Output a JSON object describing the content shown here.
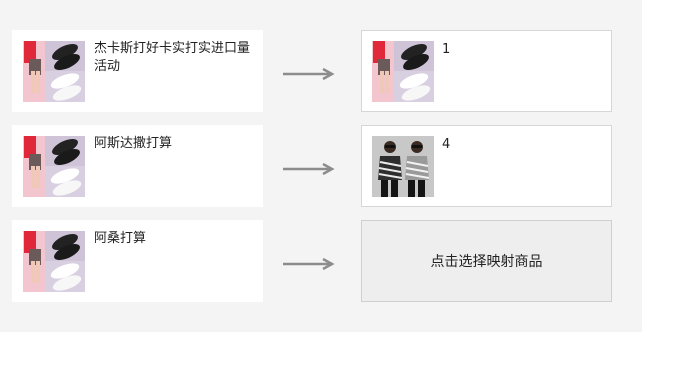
{
  "mappings": [
    {
      "source": {
        "title": "杰卡斯打好卡实打实进口量活动",
        "thumbnail": "shoes-product-icon"
      },
      "target": {
        "count": "1",
        "thumbnail": "shoes-product-icon"
      }
    },
    {
      "source": {
        "title": "阿斯达撒打算",
        "thumbnail": "shoes-product-icon"
      },
      "target": {
        "count": "4",
        "thumbnail": "tshirt-product-icon"
      }
    },
    {
      "source": {
        "title": "阿桑打算",
        "thumbnail": "shoes-product-icon"
      },
      "target": {
        "select_label": "点击选择映射商品"
      }
    }
  ],
  "colors": {
    "panel_bg": "#f4f4f4",
    "arrow": "#8c8c8c",
    "empty_target_bg": "#eeeeee"
  }
}
